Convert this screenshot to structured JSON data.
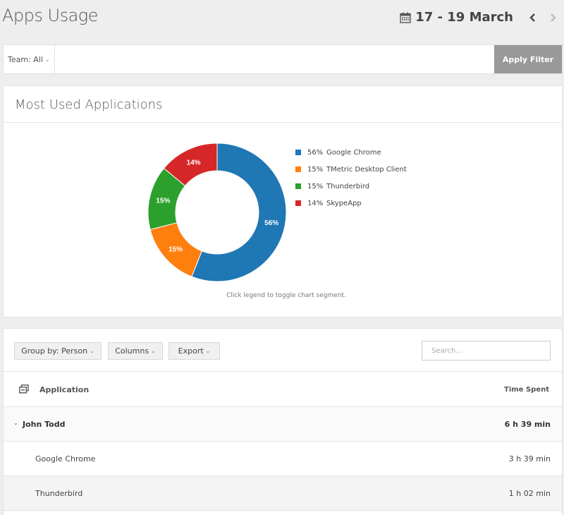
{
  "header": {
    "title": "Apps Usage",
    "date_range": "17 - 19 March",
    "icons": {
      "calendar": "calendar-icon",
      "prev": "chevron-left-icon",
      "next": "chevron-right-icon"
    }
  },
  "filter": {
    "team_label": "Team: All",
    "apply_label": "Apply Filter"
  },
  "chart_card": {
    "title": "Most Used Applications",
    "hint": "Click legend to toggle chart segment."
  },
  "chart_data": {
    "type": "pie",
    "donut": true,
    "legend_position": "right",
    "slices": [
      {
        "label": "Google Chrome",
        "value": 56,
        "pct_label": "56%",
        "color": "#1f77b4"
      },
      {
        "label": "TMetric Desktop Client",
        "value": 15,
        "pct_label": "15%",
        "color": "#ff7f0e"
      },
      {
        "label": "Thunderbird",
        "value": 15,
        "pct_label": "15%",
        "color": "#2ca02c"
      },
      {
        "label": "SkypeApp",
        "value": 14,
        "pct_label": "14%",
        "color": "#d62728"
      }
    ]
  },
  "table": {
    "toolbar": {
      "group_by": "Group by: Person",
      "columns": "Columns",
      "export": "Export",
      "search_placeholder": "Search..."
    },
    "headers": {
      "application": "Application",
      "time_spent": "Time Spent"
    },
    "group": {
      "name": "John Todd",
      "time": "6 h 39 min"
    },
    "rows": [
      {
        "name": "Google Chrome",
        "time": "3 h 39 min"
      },
      {
        "name": "Thunderbird",
        "time": "1 h 02 min"
      }
    ]
  }
}
